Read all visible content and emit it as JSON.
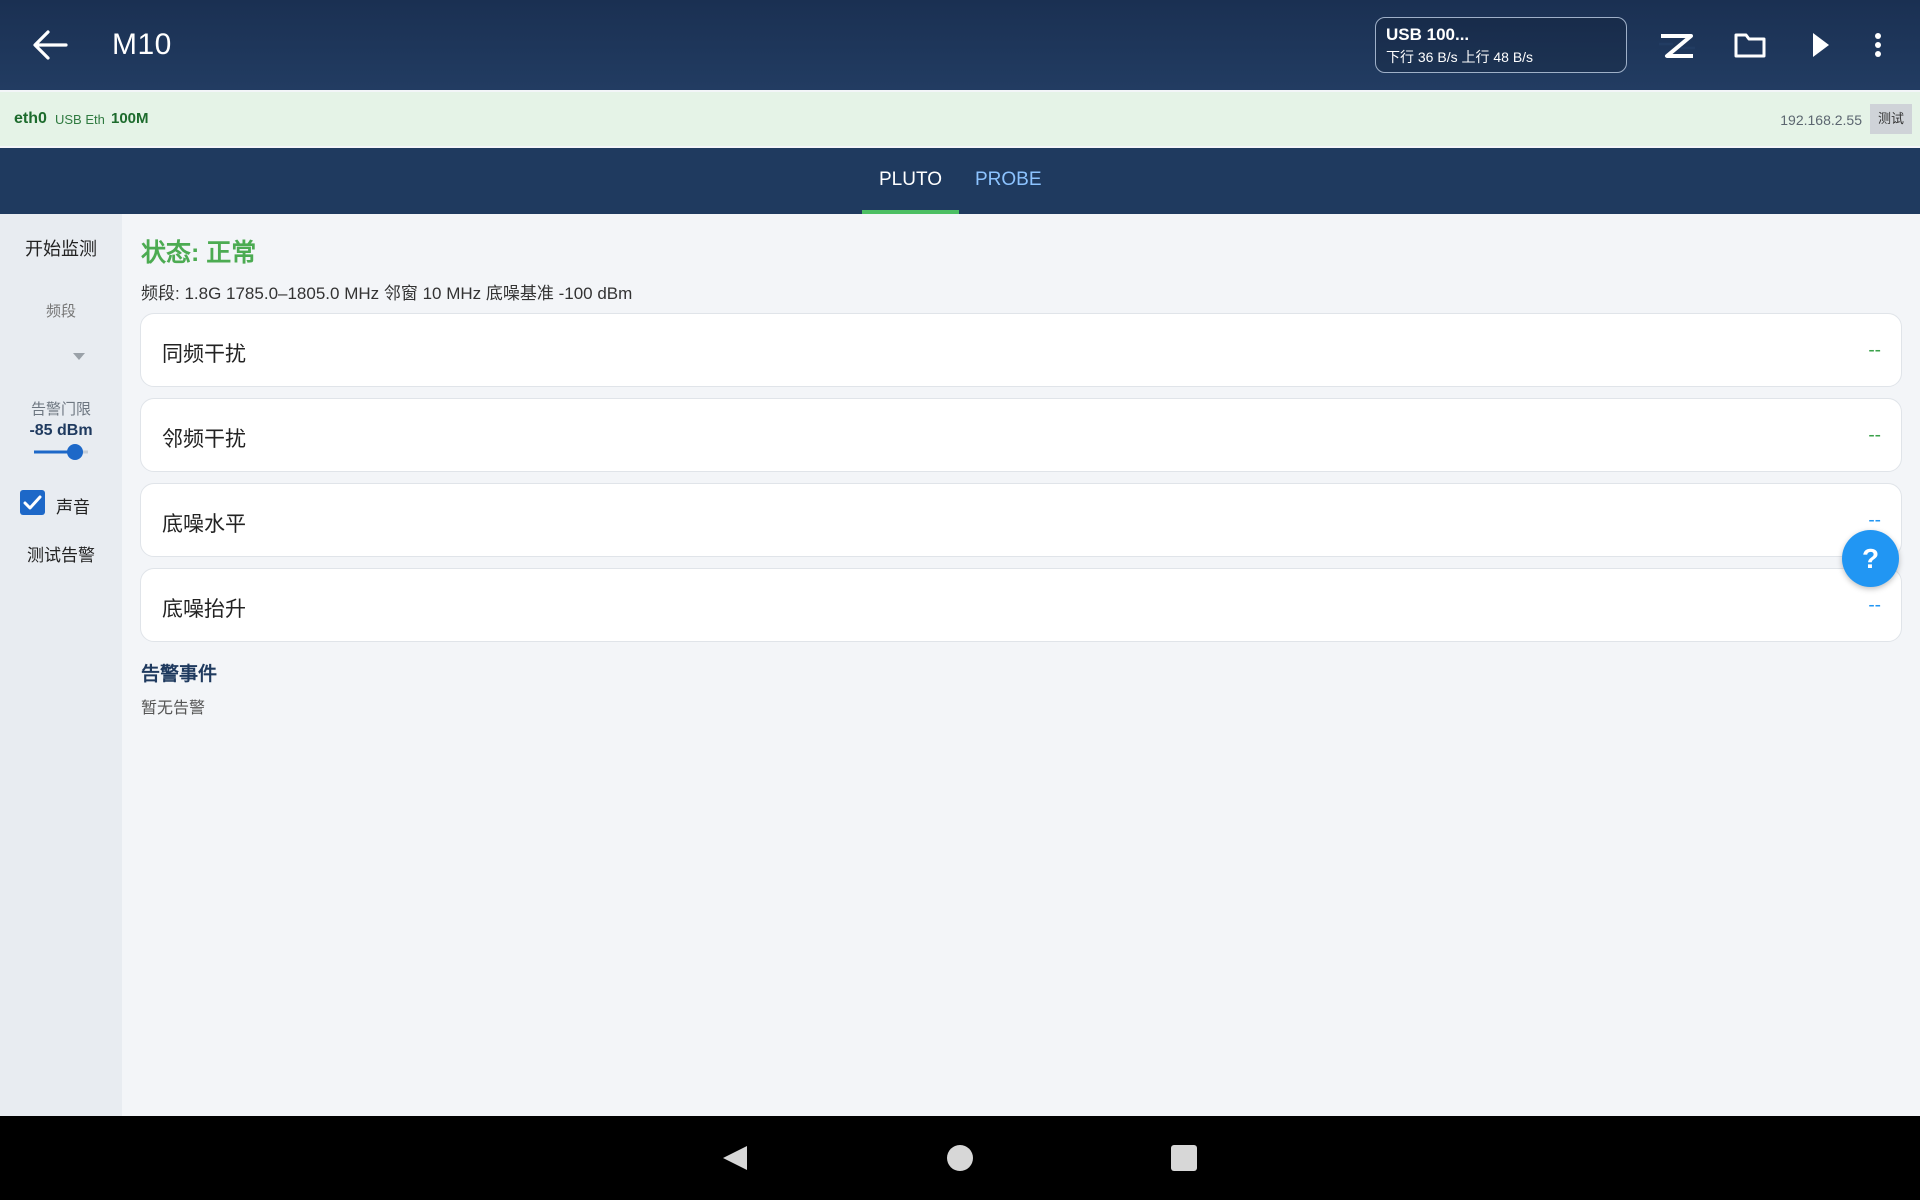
{
  "appbar": {
    "title": "M10",
    "network": {
      "name": "USB 100...",
      "rates": "下行 36 B/s 上行 48 B/s"
    },
    "icons": [
      "back-arrow-icon",
      "logo-z-icon",
      "folder-icon",
      "play-icon",
      "more-vert-icon"
    ]
  },
  "strip": {
    "interface": "eth0",
    "type": "USB Eth",
    "speed": "100M",
    "ip": "192.168.2.55",
    "test_label": "测试"
  },
  "tabs": [
    {
      "label": "PLUTO",
      "active": true
    },
    {
      "label": "PROBE",
      "active": false
    }
  ],
  "sidebar": {
    "start_label": "开始监测",
    "band_label": "频段",
    "threshold_label": "告警门限",
    "threshold_value": "-85 dBm",
    "sound_label": "声音",
    "sound_checked": true,
    "test_label": "测试告警"
  },
  "main": {
    "status": "状态: 正常",
    "info": "频段: 1.8G  1785.0–1805.0 MHz  邻窗 10 MHz  底噪基准 -100 dBm",
    "metrics": [
      {
        "name": "同频干扰",
        "value": "--",
        "color": "#3aa14a"
      },
      {
        "name": "邻频干扰",
        "value": "--",
        "color": "#3aa14a"
      },
      {
        "name": "底噪水平",
        "value": "--",
        "color": "#2196f3"
      },
      {
        "name": "底噪抬升",
        "value": "--",
        "color": "#2196f3"
      }
    ],
    "alarm_title": "告警事件",
    "alarm_text": "暂无告警"
  },
  "help_label": "?",
  "colors": {
    "appbar": "#1f3a5f",
    "accent_green": "#4cbf63",
    "status_green": "#4cab52",
    "link_blue": "#8cc3ff",
    "fab": "#2196f3"
  }
}
